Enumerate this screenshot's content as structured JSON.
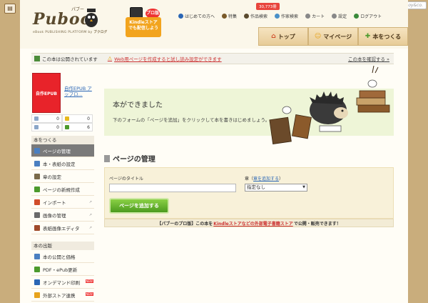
{
  "brand": {
    "logo": "Puboo",
    "logo_kana": "パブー",
    "logo_sub": "eBook PUBLISHING PLATFORM by",
    "logo_by": "ブクログ"
  },
  "kindle_badge": {
    "pro": "プロ版",
    "line1": "Kindleストア",
    "line2": "でも配信しよう"
  },
  "topnav": {
    "count": "30,773冊",
    "links": [
      {
        "label": "はじめての方へ",
        "icon": "info-icon",
        "color": "#2a66b5"
      },
      {
        "label": "特集",
        "icon": "book-icon",
        "color": "#7a5a2a"
      },
      {
        "label": "作品検索",
        "icon": "search-icon",
        "color": "#5a4a2e"
      },
      {
        "label": "作家検索",
        "icon": "user-icon",
        "color": "#4a90c8"
      },
      {
        "label": "カート",
        "icon": "cart-icon",
        "color": "#888888"
      },
      {
        "label": "設定",
        "icon": "gear-icon",
        "color": "#888888"
      },
      {
        "label": "ログアウト",
        "icon": "logout-icon",
        "color": "#3a8a3a"
      }
    ]
  },
  "paperboy": "paperboy&co.",
  "mainnav": [
    {
      "label": "トップ",
      "icon": "home-icon",
      "glyph": "⌂",
      "color": "#d14d2a"
    },
    {
      "label": "マイページ",
      "icon": "smile-icon",
      "glyph": "☺",
      "color": "#e7a31c"
    },
    {
      "label": "本をつくる",
      "icon": "plus-icon",
      "glyph": "✚",
      "color": "#4c9a2c"
    }
  ],
  "notice": {
    "status": "この本は公開されています",
    "warning": "Web用ページを作成すると試し読み設定ができます",
    "confirm": "この本を確認する »"
  },
  "book": {
    "cover_text": "自作EPUB",
    "title": "自作EPUB アップロ..."
  },
  "stats": [
    [
      "0",
      "0"
    ],
    [
      "0",
      "6"
    ]
  ],
  "sidebar": {
    "make_head": "本をつくる",
    "make_items": [
      {
        "label": "ページの管理",
        "icon": "page-icon",
        "color": "#4a7fc1",
        "active": true,
        "ext": ""
      },
      {
        "label": "本・表紙の設定",
        "icon": "book-settings-icon",
        "color": "#4a7fc1",
        "active": false,
        "ext": ""
      },
      {
        "label": "章の設定",
        "icon": "chapter-icon",
        "color": "#7a6a4a",
        "active": false,
        "ext": ""
      },
      {
        "label": "ページの新規作成",
        "icon": "new-page-icon",
        "color": "#4c9a2c",
        "active": false,
        "ext": ""
      },
      {
        "label": "インポート",
        "icon": "import-icon",
        "color": "#d14d2a",
        "active": false,
        "ext": "↗"
      },
      {
        "label": "画像の管理",
        "icon": "image-icon",
        "color": "#6a6a6a",
        "active": false,
        "ext": "↗"
      },
      {
        "label": "表紙画像エディタ",
        "icon": "cover-editor-icon",
        "color": "#a04a2a",
        "active": false,
        "ext": "↗"
      }
    ],
    "publish_head": "本の出版",
    "publish_items": [
      {
        "label": "本の公開と価格",
        "icon": "publish-icon",
        "color": "#4a7fc1",
        "newtag": ""
      },
      {
        "label": "PDF・ePub更新",
        "icon": "pdf-icon",
        "color": "#4c9a2c",
        "newtag": ""
      },
      {
        "label": "オンデマンド印刷",
        "icon": "print-icon",
        "color": "#2a66b5",
        "newtag": "NEW"
      },
      {
        "label": "外部ストア連携",
        "icon": "store-icon",
        "color": "#e7a31c",
        "newtag": "NEW"
      }
    ]
  },
  "hero": {
    "title": "本ができました",
    "desc": "「ページを追加」をクリックして本を書きはじめましょう。",
    "desc_prefix": "下のフォームの"
  },
  "manage": {
    "title": "ページの管理",
    "title_label": "ページのタイトル",
    "title_value": "",
    "chapter_label": "章",
    "chapter_link": "章を追加する",
    "chapter_selected": "指定なし",
    "add_button": "ページを追加する"
  },
  "promo": {
    "part1": "【パブーのプロ版】この本を",
    "part2": "Kindleストアなどの外部電子書籍ストア",
    "part3": "で公開・販売できます！"
  },
  "colors": {
    "accent_green": "#4b9a1e",
    "hero_bg": "#eef5d7",
    "frame": "#c9ad7c"
  }
}
